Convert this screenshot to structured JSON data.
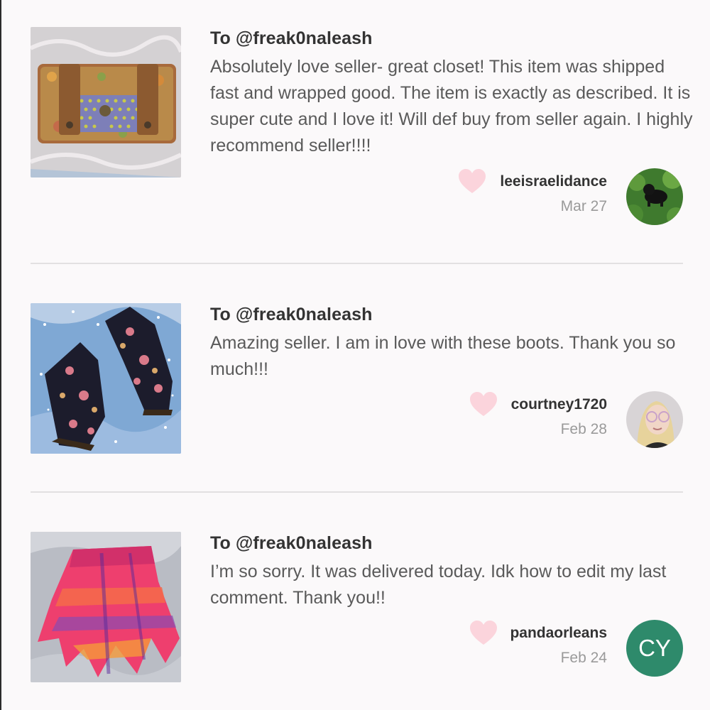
{
  "reviews": [
    {
      "to": "To @freak0naleash",
      "text": "Absolutely love seller- great closet! This item was shipped fast and wrapped good. The item is exactly as described. It is super cute and I love it! Will def buy from seller again. I highly recommend seller!!!!",
      "username": "leeisraelidance",
      "date": "Mar 27",
      "item_image": "floral-wallet-photo",
      "avatar": "dog-in-grass-photo"
    },
    {
      "to": "To @freak0naleash",
      "text": "Amazing seller. I am in love with these boots. Thank you so much!!!",
      "username": "courtney1720",
      "date": "Feb 28",
      "item_image": "floral-boots-photo",
      "avatar": "selfie-with-glasses-photo"
    },
    {
      "to": "To @freak0naleash",
      "text": "I’m so sorry. It was delivered today. Idk how to edit my last comment. Thank you!!",
      "username": "pandaorleans",
      "date": "Feb 24",
      "item_image": "tie-dye-skirt-photo",
      "avatar_initials": "CY"
    }
  ],
  "colors": {
    "background": "#fbf9fa",
    "heart": "#fbd4dc",
    "divider": "#e2e0e1",
    "avatar_initials_bg": "#2e8a6b"
  }
}
